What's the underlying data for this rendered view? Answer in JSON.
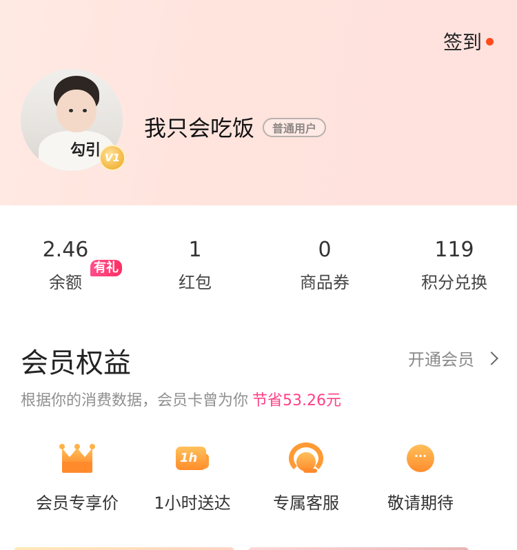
{
  "header": {
    "signin_label": "签到",
    "avatar_caption": "勾引",
    "vip_level": "V1",
    "username": "我只会吃饭",
    "user_type": "普通用户"
  },
  "stats": [
    {
      "value": "2.46",
      "label": "余额",
      "badge": "有礼"
    },
    {
      "value": "1",
      "label": "红包"
    },
    {
      "value": "0",
      "label": "商品券"
    },
    {
      "value": "119",
      "label": "积分兑换"
    }
  ],
  "membership": {
    "title": "会员权益",
    "open_label": "开通会员",
    "desc_prefix": "根据你的消费数据，会员卡曾为你",
    "desc_saving": "节省53.26元"
  },
  "benefits": [
    {
      "label": "会员专享价",
      "icon": "crown-icon"
    },
    {
      "label": "1小时送达",
      "icon": "delivery-truck-icon",
      "icon_text": "1h"
    },
    {
      "label": "专属客服",
      "icon": "customer-service-icon"
    },
    {
      "label": "敬请期待",
      "icon": "more-icon",
      "icon_text": "···"
    }
  ],
  "colors": {
    "accent_orange": "#ff8d2a",
    "saving_pink": "#ff3f86",
    "signin_dot": "#ff4a1c"
  }
}
